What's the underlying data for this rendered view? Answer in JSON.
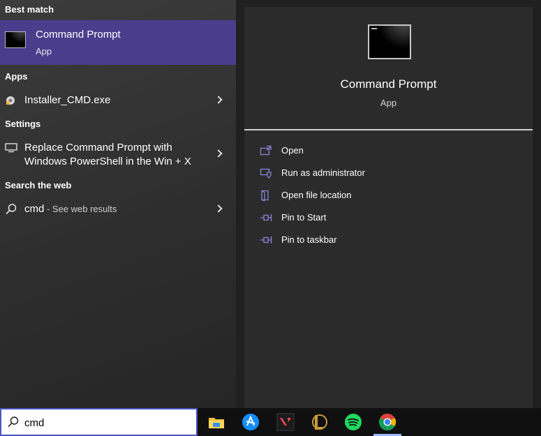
{
  "left_panel": {
    "best_match_header": "Best match",
    "best_match": {
      "name": "Command Prompt",
      "type": "App"
    },
    "apps_header": "Apps",
    "apps": [
      {
        "label": "Installer_CMD.exe"
      }
    ],
    "settings_header": "Settings",
    "settings": [
      {
        "line1": "Replace Command Prompt with",
        "line2": "Windows PowerShell in the Win + X"
      }
    ],
    "web_header": "Search the web",
    "web": {
      "query": "cmd",
      "suffix": " - See web results"
    }
  },
  "right_panel": {
    "title": "Command Prompt",
    "type": "App",
    "actions": [
      {
        "label": "Open",
        "icon": "open-icon"
      },
      {
        "label": "Run as administrator",
        "icon": "shield-icon"
      },
      {
        "label": "Open file location",
        "icon": "file-location-icon"
      },
      {
        "label": "Pin to Start",
        "icon": "pin-icon"
      },
      {
        "label": "Pin to taskbar",
        "icon": "pin-icon"
      }
    ]
  },
  "taskbar": {
    "search_value": "cmd",
    "apps": [
      {
        "name": "file-explorer-icon"
      },
      {
        "name": "battle-net-icon"
      },
      {
        "name": "valorant-icon"
      },
      {
        "name": "league-of-legends-icon"
      },
      {
        "name": "spotify-icon"
      },
      {
        "name": "chrome-icon"
      }
    ]
  },
  "colors": {
    "accent": "#4a3d8c",
    "action_icon": "#8b84d6",
    "search_border": "#4a56c6"
  }
}
